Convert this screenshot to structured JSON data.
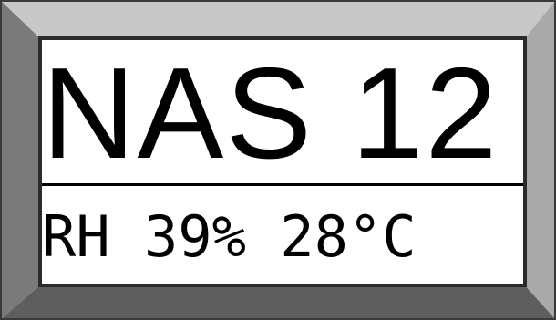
{
  "display": {
    "title": "NAS 12",
    "readout": "RH 39% 28°C"
  },
  "colors": {
    "bezel_top": "#c0c0c0",
    "bezel_left": "#808080",
    "bezel_right": "#a8a8a8",
    "bezel_bottom": "#606060",
    "screen": "#ffffff",
    "text": "#000000"
  }
}
